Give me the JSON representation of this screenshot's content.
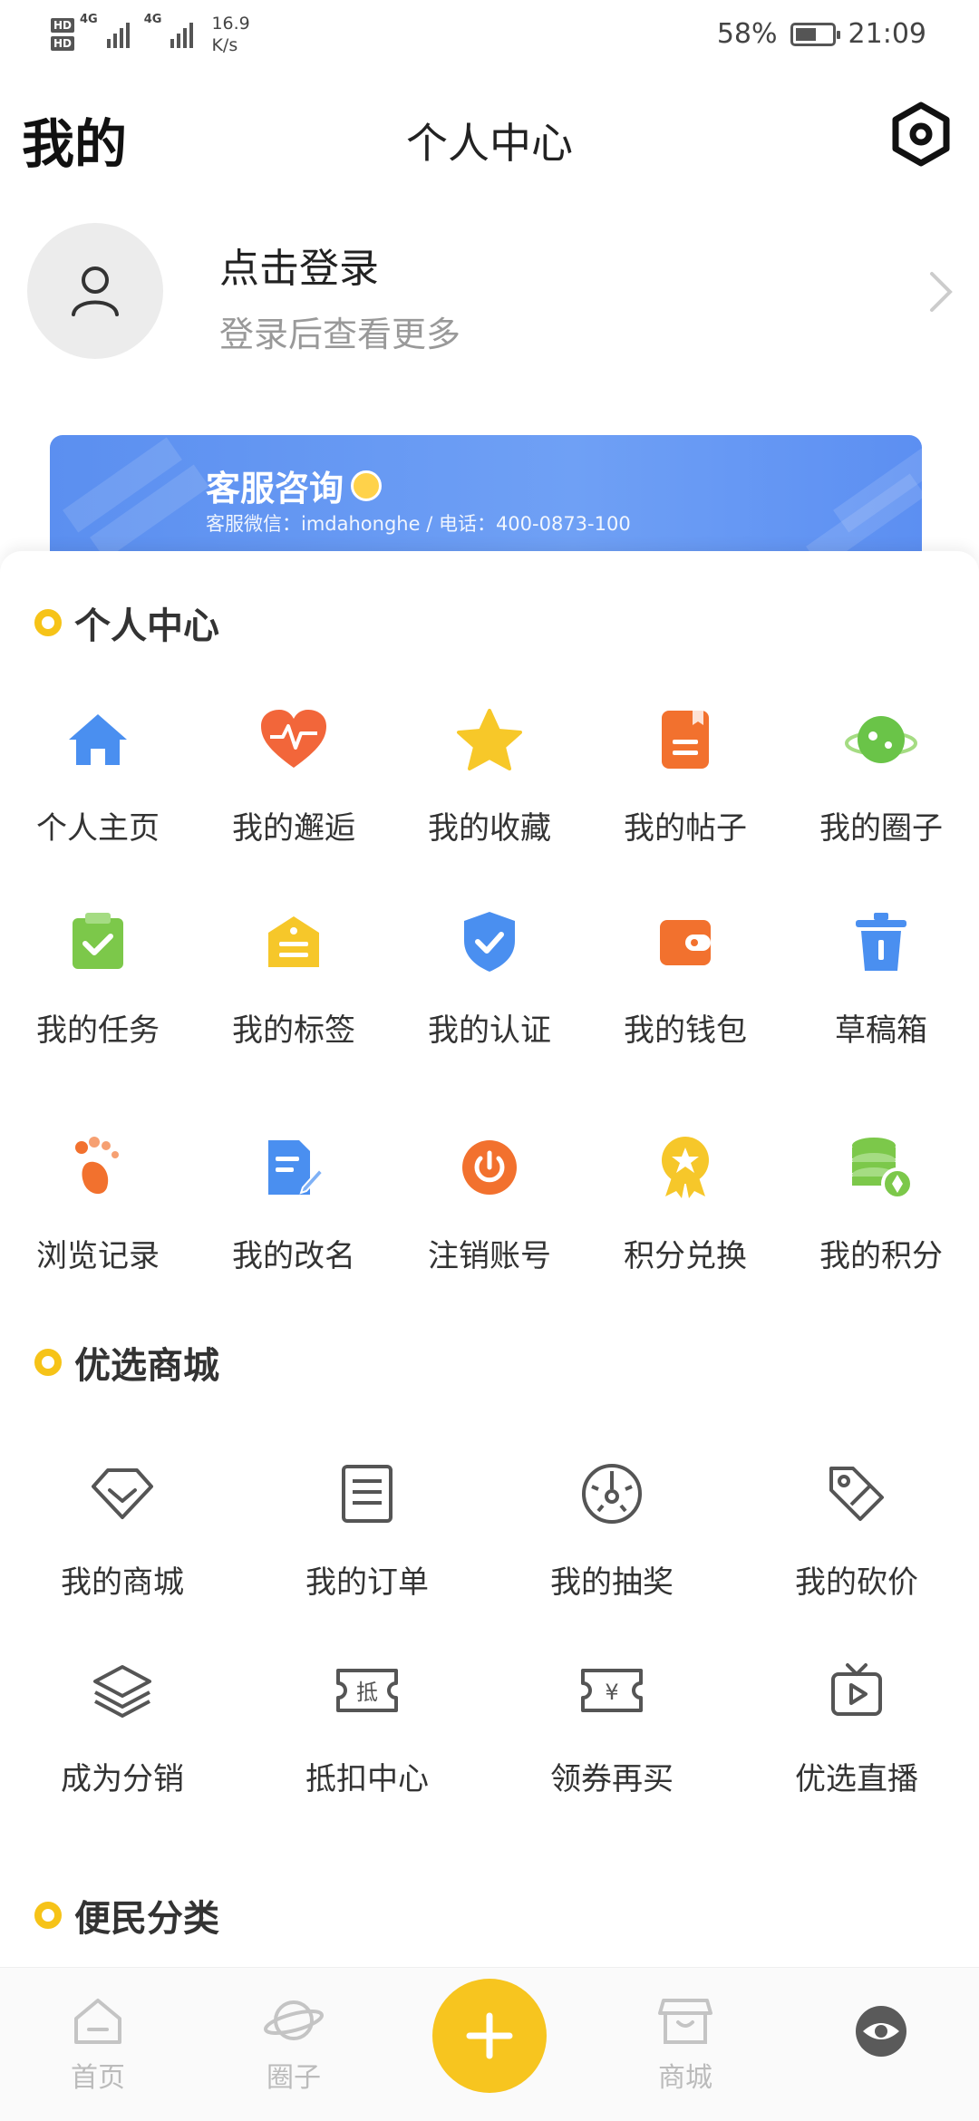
{
  "status_bar": {
    "hd1": "HD",
    "hd2": "HD",
    "net1": "4G",
    "net2": "4G",
    "speed_value": "16.9",
    "speed_unit": "K/s",
    "battery": "58%",
    "battery_level": 0.58,
    "time": "21:09"
  },
  "header": {
    "left": "我的",
    "title": "个人中心",
    "settings_icon": "settings-hex-icon"
  },
  "profile": {
    "name": "点击登录",
    "subtitle": "登录后查看更多"
  },
  "banner": {
    "title": "客服咨询",
    "info": "客服微信：imdahonghe / 电话：400-0873-100"
  },
  "sections": {
    "personal": "个人中心",
    "mall": "优选商城",
    "service": "便民分类"
  },
  "personal_items": [
    {
      "label": "个人主页",
      "icon": "home-icon",
      "color": "#4a8ff0"
    },
    {
      "label": "我的邂逅",
      "icon": "heart-pulse-icon",
      "color": "#f2663a"
    },
    {
      "label": "我的收藏",
      "icon": "star-icon",
      "color": "#f7c829"
    },
    {
      "label": "我的帖子",
      "icon": "post-icon",
      "color": "#f2712e"
    },
    {
      "label": "我的圈子",
      "icon": "planet-icon",
      "color": "#6ac448"
    },
    {
      "label": "我的任务",
      "icon": "task-icon",
      "color": "#7cc84a"
    },
    {
      "label": "我的标签",
      "icon": "tag-icon",
      "color": "#f6c72a"
    },
    {
      "label": "我的认证",
      "icon": "shield-check-icon",
      "color": "#4a8ff0"
    },
    {
      "label": "我的钱包",
      "icon": "wallet-icon",
      "color": "#f2712e"
    },
    {
      "label": "草稿箱",
      "icon": "trash-icon",
      "color": "#4a8ff0"
    },
    {
      "label": "浏览记录",
      "icon": "footprint-icon",
      "color": "#f2712e"
    },
    {
      "label": "我的改名",
      "icon": "edit-doc-icon",
      "color": "#4a8ff0"
    },
    {
      "label": "注销账号",
      "icon": "power-icon",
      "color": "#f2712e"
    },
    {
      "label": "积分兑换",
      "icon": "medal-icon",
      "color": "#f6c72a"
    },
    {
      "label": "我的积分",
      "icon": "coins-icon",
      "color": "#7cc84a"
    }
  ],
  "mall_items": [
    {
      "label": "我的商城",
      "icon": "diamond-icon"
    },
    {
      "label": "我的订单",
      "icon": "order-list-icon"
    },
    {
      "label": "我的抽奖",
      "icon": "lottery-wheel-icon"
    },
    {
      "label": "我的砍价",
      "icon": "price-tag-icon"
    },
    {
      "label": "成为分销",
      "icon": "layers-icon"
    },
    {
      "label": "抵扣中心",
      "icon": "deduct-ticket-icon"
    },
    {
      "label": "领券再买",
      "icon": "coupon-yen-icon"
    },
    {
      "label": "优选直播",
      "icon": "live-tv-icon"
    }
  ],
  "deduct_glyph": "抵",
  "yen_glyph": "¥",
  "tabbar": [
    {
      "label": "首页",
      "icon": "home-outline-icon"
    },
    {
      "label": "圈子",
      "icon": "planet-outline-icon"
    },
    {
      "label": "",
      "icon": "plus-icon"
    },
    {
      "label": "商城",
      "icon": "shop-outline-icon"
    },
    {
      "label": "",
      "icon": "eye-icon"
    }
  ],
  "colors": {
    "accent": "#f7c51f",
    "banner": "#5b8ff0",
    "tab_inactive": "#bbbbbb",
    "tab_active": "#555555"
  }
}
